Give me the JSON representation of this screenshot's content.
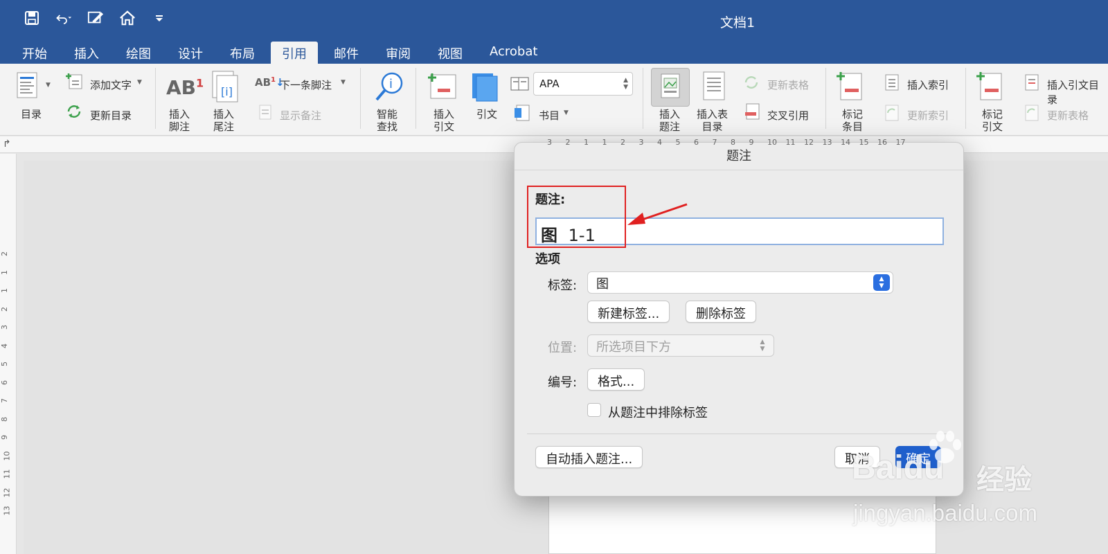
{
  "window": {
    "title": "文档1"
  },
  "tabs": [
    "开始",
    "插入",
    "绘图",
    "设计",
    "布局",
    "引用",
    "邮件",
    "审阅",
    "视图",
    "Acrobat"
  ],
  "active_tab": "引用",
  "ribbon": {
    "toc": "目录",
    "add_text": "添加文字",
    "update_toc": "更新目录",
    "insert_footnote": [
      "插入",
      "脚注"
    ],
    "insert_endnote": [
      "插入",
      "尾注"
    ],
    "next_footnote": "下一条脚注",
    "show_notes": "显示备注",
    "smart_lookup": [
      "智能",
      "查找"
    ],
    "insert_citation": [
      "插入",
      "引文"
    ],
    "citations": "引文",
    "style_select": "APA",
    "bibliography": "书目",
    "insert_caption": [
      "插入",
      "题注"
    ],
    "insert_table_of_figures": [
      "插入表",
      "目录"
    ],
    "update_table": "更新表格",
    "cross_reference": "交叉引用",
    "mark_entry": [
      "标记",
      "条目"
    ],
    "insert_index": "插入索引",
    "update_index": "更新索引",
    "mark_citation": [
      "标记",
      "引文"
    ],
    "insert_toa": "插入引文目录",
    "update_table_2": "更新表格"
  },
  "ruler_h": [
    "3",
    "2",
    "1",
    "1",
    "2",
    "3",
    "4",
    "5",
    "6",
    "7",
    "8",
    "9",
    "10",
    "11",
    "12",
    "13",
    "14",
    "15",
    "16",
    "17"
  ],
  "ruler_v": [
    "2",
    "1",
    "1",
    "2",
    "3",
    "4",
    "5",
    "6",
    "7",
    "8",
    "9",
    "10",
    "11",
    "12",
    "13"
  ],
  "dialog": {
    "title": "题注",
    "caption_label": "题注:",
    "caption_value_label": "图",
    "caption_value_number": "1-1",
    "options_heading": "选项",
    "label_label": "标签:",
    "label_value": "图",
    "new_label_button": "新建标签...",
    "delete_label_button": "删除标签",
    "position_label": "位置:",
    "position_value": "所选项目下方",
    "numbering_label": "编号:",
    "format_button": "格式...",
    "exclude_label_checkbox": "从题注中排除标签",
    "exclude_label_checked": false,
    "autocaption_button": "自动插入题注...",
    "cancel_button": "取消",
    "ok_button": "确定"
  },
  "watermark": {
    "brand": "Baidu",
    "cn": "经验",
    "url": "jingyan.baidu.com"
  },
  "colors": {
    "titlebar": "#2b579a",
    "accent": "#1f5fcc",
    "annotation": "#e02020"
  }
}
